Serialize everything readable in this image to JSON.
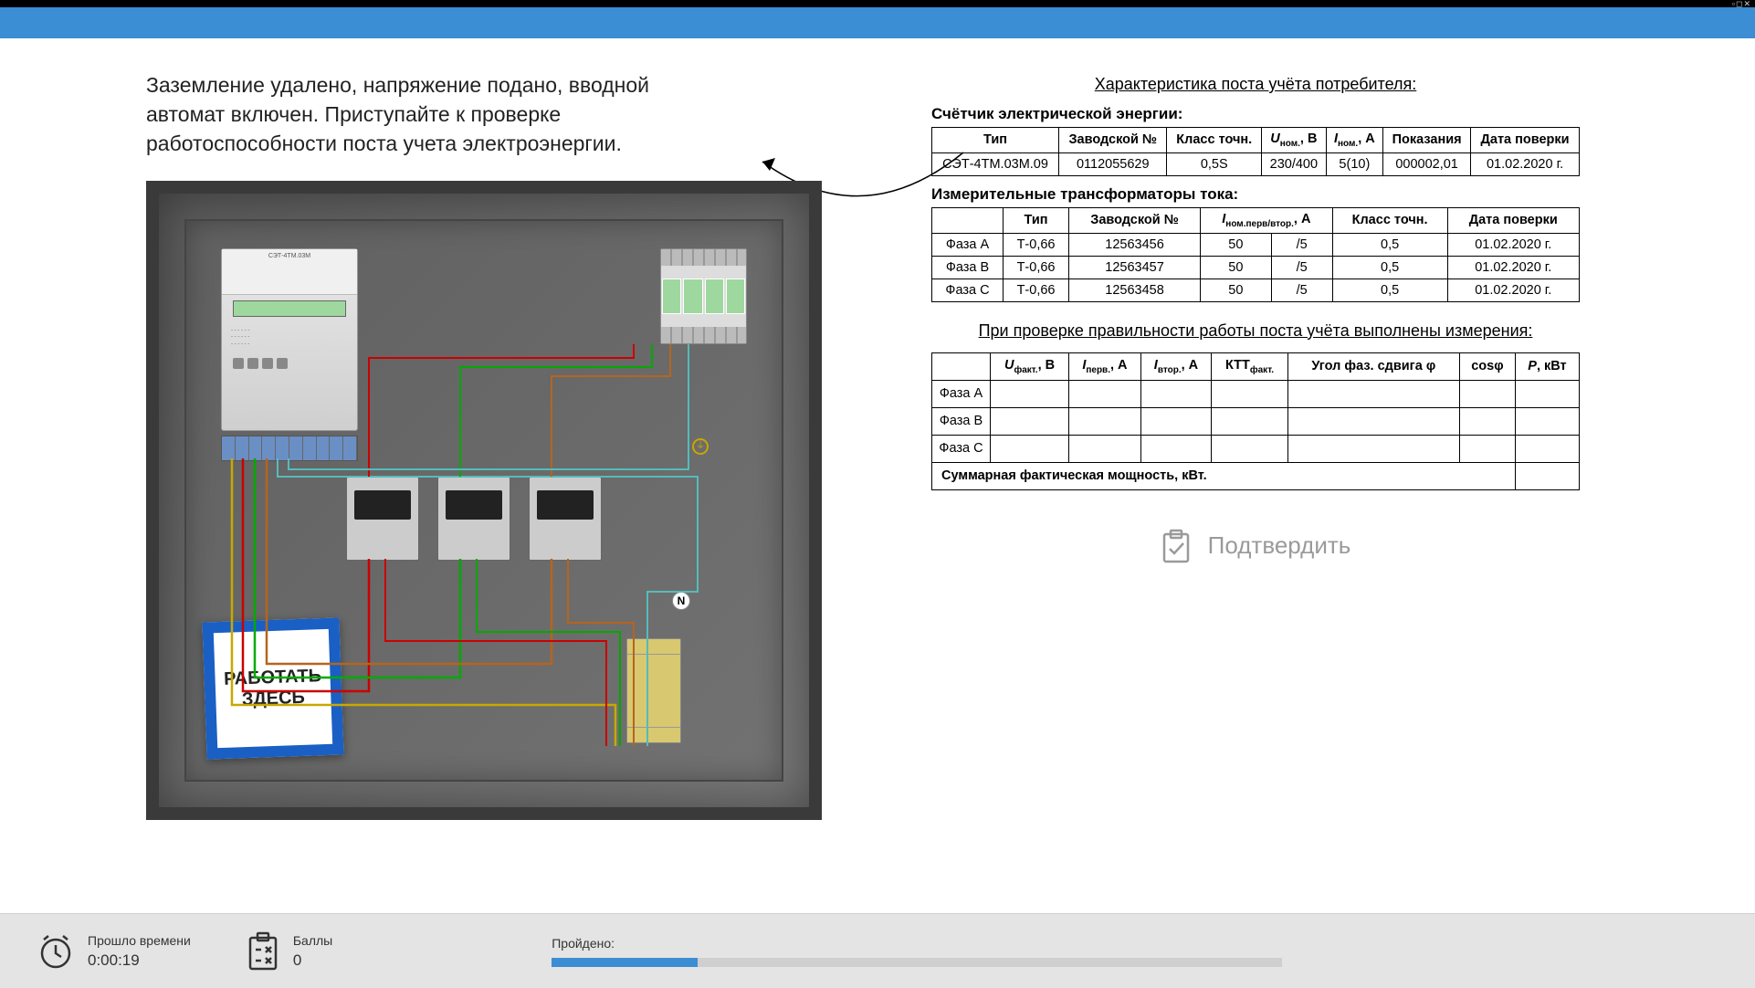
{
  "window": {
    "controls": "▫◻✕"
  },
  "instruction": "Заземление удалено, напряжение подано, вводной автомат включен. Приступайте к проверке работоспособности поста учета электроэнергии.",
  "cabinet": {
    "sign": "РАБОТАТЬ ЗДЕСЬ",
    "neutral": "N",
    "meter_model": "СЭТ-4ТМ.03М"
  },
  "doc": {
    "title": "Характеристика поста учёта потребителя:",
    "meter_section": "Счётчик электрической энергии:",
    "meter_headers": {
      "type": "Тип",
      "serial": "Заводской №",
      "accuracy": "Класс точн.",
      "u_nom": "U",
      "u_nom_sub": "ном.",
      "u_unit": ", В",
      "i_nom": "I",
      "i_nom_sub": "ном.",
      "i_unit": ", А",
      "reading": "Показания",
      "date": "Дата поверки"
    },
    "meter_row": {
      "type": "СЭТ-4ТМ.03М.09",
      "serial": "0112055629",
      "accuracy": "0,5S",
      "u": "230/400",
      "i": "5(10)",
      "reading": "000002,01",
      "date": "01.02.2020 г."
    },
    "ct_section": "Измерительные трансформаторы тока:",
    "ct_headers": {
      "phase": "",
      "type": "Тип",
      "serial": "Заводской №",
      "i_nom": "I",
      "i_nom_sub": "ном.перв/втор.",
      "i_unit": ", А",
      "accuracy": "Класс точн.",
      "date": "Дата поверки"
    },
    "ct_rows": [
      {
        "phase": "Фаза A",
        "type": "Т-0,66",
        "serial": "12563456",
        "i1": "50",
        "i2": "/5",
        "accuracy": "0,5",
        "date": "01.02.2020 г."
      },
      {
        "phase": "Фаза B",
        "type": "Т-0,66",
        "serial": "12563457",
        "i1": "50",
        "i2": "/5",
        "accuracy": "0,5",
        "date": "01.02.2020 г."
      },
      {
        "phase": "Фаза C",
        "type": "Т-0,66",
        "serial": "12563458",
        "i1": "50",
        "i2": "/5",
        "accuracy": "0,5",
        "date": "01.02.2020 г."
      }
    ],
    "meas_title": "При проверке правильности работы поста учёта выполнены измерения:",
    "meas_headers": {
      "phase": "",
      "u": "U",
      "u_sub": "факт.",
      "u_unit": ", В",
      "i1": "I",
      "i1_sub": "перв.",
      "i1_unit": ", А",
      "i2": "I",
      "i2_sub": "втор.",
      "i2_unit": ", А",
      "ktt": "КТТ",
      "ktt_sub": "факт.",
      "angle": "Угол фаз. сдвига φ",
      "cos": "cosφ",
      "p": "P",
      "p_unit": ", кВт"
    },
    "meas_phases": [
      "Фаза A",
      "Фаза B",
      "Фаза C"
    ],
    "summary": "Суммарная фактическая мощность, кВт."
  },
  "confirm_label": "Подтвердить",
  "footer": {
    "time_label": "Прошло времени",
    "time_value": "0:00:19",
    "score_label": "Баллы",
    "score_value": "0",
    "progress_label": "Пройдено:",
    "progress_pct": 20
  }
}
